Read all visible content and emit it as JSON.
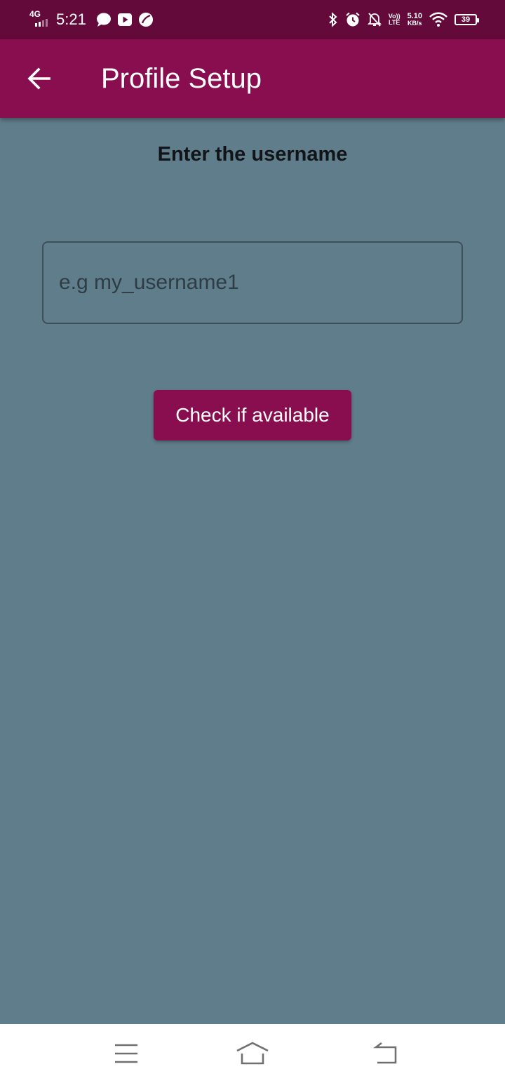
{
  "status_bar": {
    "network_type": "4G",
    "time": "5:21",
    "volte_top": "Vo))",
    "volte_bottom": "LTE",
    "speed_value": "5.10",
    "speed_unit": "KB/s",
    "battery_level": "39",
    "notification_icons": [
      "chat-bubble-icon",
      "youtube-icon",
      "leaf-icon"
    ],
    "system_icons": [
      "bluetooth-icon",
      "alarm-icon",
      "notifications-off-icon",
      "wifi-icon",
      "battery-icon"
    ]
  },
  "app_bar": {
    "title": "Profile Setup",
    "back_icon": "arrow-back-icon"
  },
  "form": {
    "prompt": "Enter the username",
    "username_value": "",
    "username_placeholder": "e.g my_username1",
    "submit_label": "Check if available"
  },
  "nav_bar": {
    "icons": [
      "menu-icon",
      "home-icon",
      "back-icon"
    ]
  },
  "colors": {
    "status_bar": "#640a3a",
    "app_bar": "#880e4f",
    "background": "#607d8b",
    "button": "#880e4f",
    "nav_bar": "#ffffff"
  }
}
